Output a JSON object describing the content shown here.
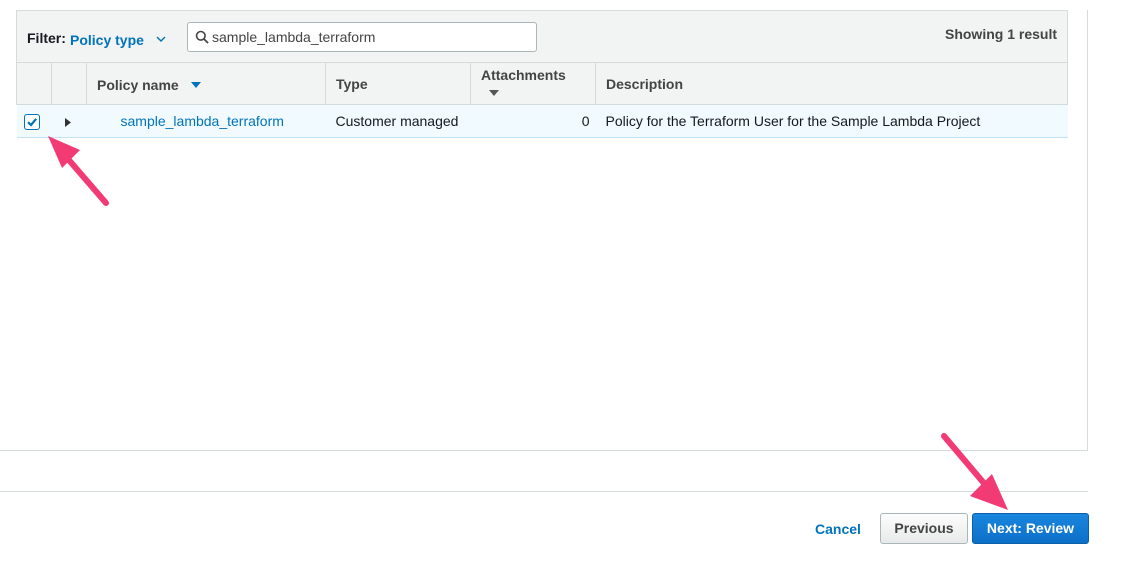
{
  "filter": {
    "label": "Filter:",
    "dropdown_value": "Policy type",
    "search_value": "sample_lambda_terraform",
    "result_count_text": "Showing 1 result"
  },
  "table": {
    "columns": [
      "Policy name",
      "Type",
      "Attachments",
      "Description"
    ],
    "rows": [
      {
        "selected": true,
        "name": "sample_lambda_terraform",
        "type": "Customer managed",
        "attachments": "0",
        "description": "Policy for the Terraform User for the Sample Lambda Project"
      }
    ]
  },
  "footer": {
    "cancel_label": "Cancel",
    "previous_label": "Previous",
    "next_label": "Next: Review"
  },
  "colors": {
    "link": "#0073bb",
    "annotation_arrow": "#f23b74",
    "primary_button": "#1a86de"
  },
  "icons": [
    "search-icon",
    "chevron-down-icon",
    "sort-down-icon",
    "checkmark-icon",
    "expand-caret-icon",
    "annotation-arrow-icon"
  ]
}
